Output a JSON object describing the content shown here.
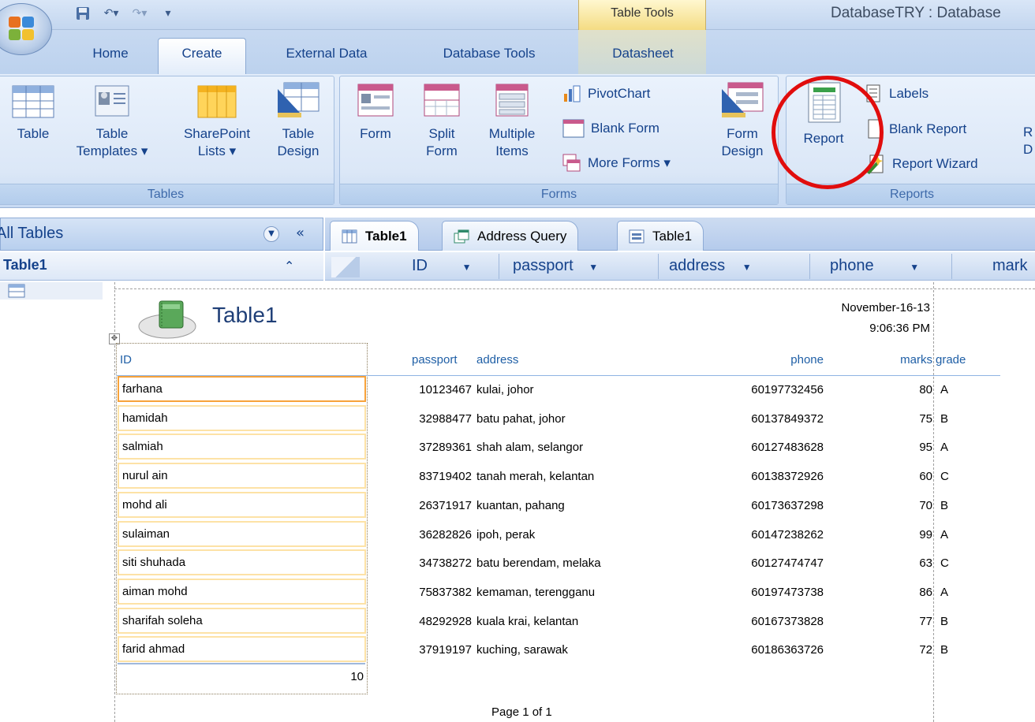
{
  "window": {
    "contextual_tab_group": "Table Tools",
    "title": "DatabaseTRY : Database"
  },
  "ribbon": {
    "tabs": [
      "Home",
      "Create",
      "External Data",
      "Database Tools",
      "Datasheet"
    ],
    "active_tab": "Create",
    "groups": {
      "tables": {
        "label": "Tables",
        "table": "Table",
        "table_templates": [
          "Table",
          "Templates ▾"
        ],
        "sharepoint_lists": [
          "SharePoint",
          "Lists ▾"
        ],
        "table_design": [
          "Table",
          "Design"
        ]
      },
      "forms": {
        "label": "Forms",
        "form": "Form",
        "split_form": [
          "Split",
          "Form"
        ],
        "multiple_items": [
          "Multiple",
          "Items"
        ],
        "pivotchart": "PivotChart",
        "blank_form": "Blank Form",
        "more_forms": "More Forms ▾",
        "form_design": [
          "Form",
          "Design"
        ]
      },
      "reports": {
        "label": "Reports",
        "report": "Report",
        "labels": "Labels",
        "blank_report": "Blank Report",
        "report_wizard": "Report Wizard",
        "report_design_peek": [
          "R",
          "D"
        ]
      }
    }
  },
  "nav": {
    "title": "All Tables",
    "collapse_glyph": "«",
    "group_title": "Table1",
    "group_toggle_glyph": "⌃"
  },
  "document_tabs": [
    "Table1",
    "Address Query",
    "Table1"
  ],
  "datasheet_columns": [
    "ID",
    "passport",
    "address",
    "phone",
    "mark"
  ],
  "report": {
    "title": "Table1",
    "date": "November-16-13",
    "time": "9:06:36 PM",
    "headers": {
      "id": "ID",
      "passport": "passport",
      "address": "address",
      "phone": "phone",
      "marks": "marks",
      "grade": "grade"
    },
    "rows": [
      {
        "id": "farhana",
        "passport": "10123467",
        "address": "kulai, johor",
        "phone": "60197732456",
        "marks": "80",
        "grade": "A"
      },
      {
        "id": "hamidah",
        "passport": "32988477",
        "address": "batu pahat, johor",
        "phone": "60137849372",
        "marks": "75",
        "grade": "B"
      },
      {
        "id": "salmiah",
        "passport": "37289361",
        "address": "shah alam, selangor",
        "phone": "60127483628",
        "marks": "95",
        "grade": "A"
      },
      {
        "id": "nurul ain",
        "passport": "83719402",
        "address": "tanah merah, kelantan",
        "phone": "60138372926",
        "marks": "60",
        "grade": "C"
      },
      {
        "id": "mohd ali",
        "passport": "26371917",
        "address": "kuantan, pahang",
        "phone": "60173637298",
        "marks": "70",
        "grade": "B"
      },
      {
        "id": "sulaiman",
        "passport": "36282826",
        "address": "ipoh, perak",
        "phone": "60147238262",
        "marks": "99",
        "grade": "A"
      },
      {
        "id": "siti shuhada",
        "passport": "34738272",
        "address": "batu berendam, melaka",
        "phone": "60127474747",
        "marks": "63",
        "grade": "C"
      },
      {
        "id": "aiman mohd",
        "passport": "75837382",
        "address": "kemaman, terengganu",
        "phone": "60197473738",
        "marks": "86",
        "grade": "A"
      },
      {
        "id": "sharifah soleha",
        "passport": "48292928",
        "address": "kuala krai, kelantan",
        "phone": "60167373828",
        "marks": "77",
        "grade": "B"
      },
      {
        "id": "farid ahmad",
        "passport": "37919197",
        "address": "kuching, sarawak",
        "phone": "60186363726",
        "marks": "72",
        "grade": "B"
      }
    ],
    "count": "10",
    "footer": "Page 1 of 1"
  },
  "annotation": {
    "shape": "circle",
    "color": "#e10d0d",
    "target": "Report button"
  }
}
